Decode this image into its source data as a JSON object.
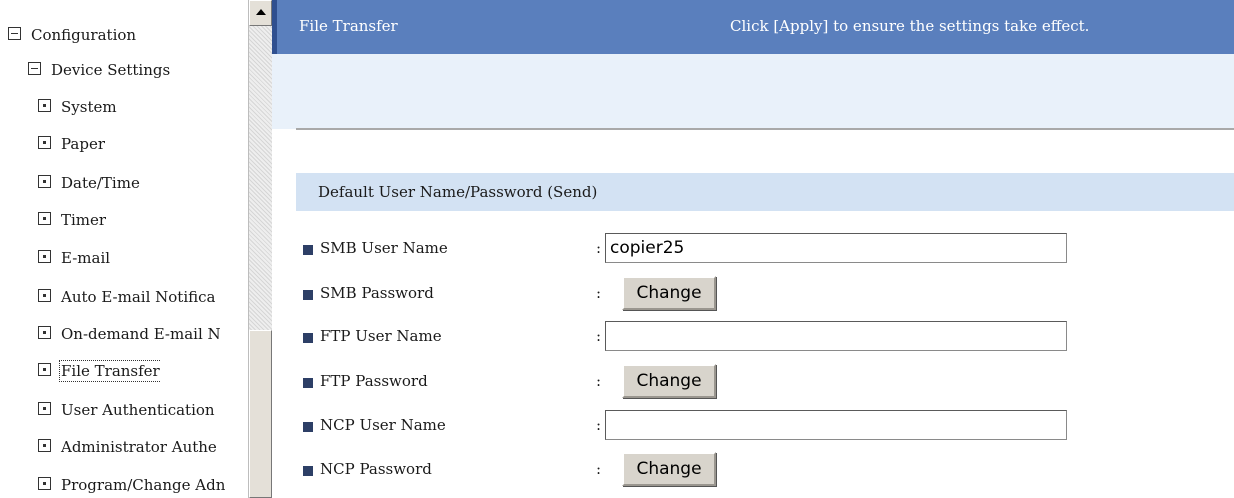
{
  "nav": {
    "items": [
      {
        "label": "Configuration",
        "expander": "minus"
      },
      {
        "label": "Device Settings",
        "expander": "minus"
      },
      {
        "label": "System",
        "expander": "dot"
      },
      {
        "label": "Paper",
        "expander": "dot"
      },
      {
        "label": "Date/Time",
        "expander": "dot"
      },
      {
        "label": "Timer",
        "expander": "dot"
      },
      {
        "label": "E-mail",
        "expander": "dot"
      },
      {
        "label": "Auto E-mail Notifica",
        "expander": "dot"
      },
      {
        "label": "On-demand E-mail N",
        "expander": "dot"
      },
      {
        "label": "File Transfer",
        "expander": "dot",
        "selected": true
      },
      {
        "label": "User Authentication",
        "expander": "dot"
      },
      {
        "label": "Administrator Authe",
        "expander": "dot"
      },
      {
        "label": "Program/Change Adn",
        "expander": "dot"
      }
    ]
  },
  "header": {
    "title": "File Transfer",
    "hint": "Click [Apply] to ensure the settings take effect."
  },
  "section": {
    "title": "Default User Name/Password (Send)"
  },
  "fields": [
    {
      "label": "SMB User Name",
      "type": "text",
      "value": "copier25"
    },
    {
      "label": "SMB Password",
      "type": "button",
      "button_label": "Change"
    },
    {
      "label": "FTP User Name",
      "type": "text",
      "value": ""
    },
    {
      "label": "FTP Password",
      "type": "button",
      "button_label": "Change"
    },
    {
      "label": "NCP User Name",
      "type": "text",
      "value": ""
    },
    {
      "label": "NCP Password",
      "type": "button",
      "button_label": "Change"
    }
  ],
  "colon": ":",
  "colors": {
    "title_bar": "#5a7fbd",
    "section_header": "#d3e2f3",
    "bullet": "#2d3f66"
  }
}
